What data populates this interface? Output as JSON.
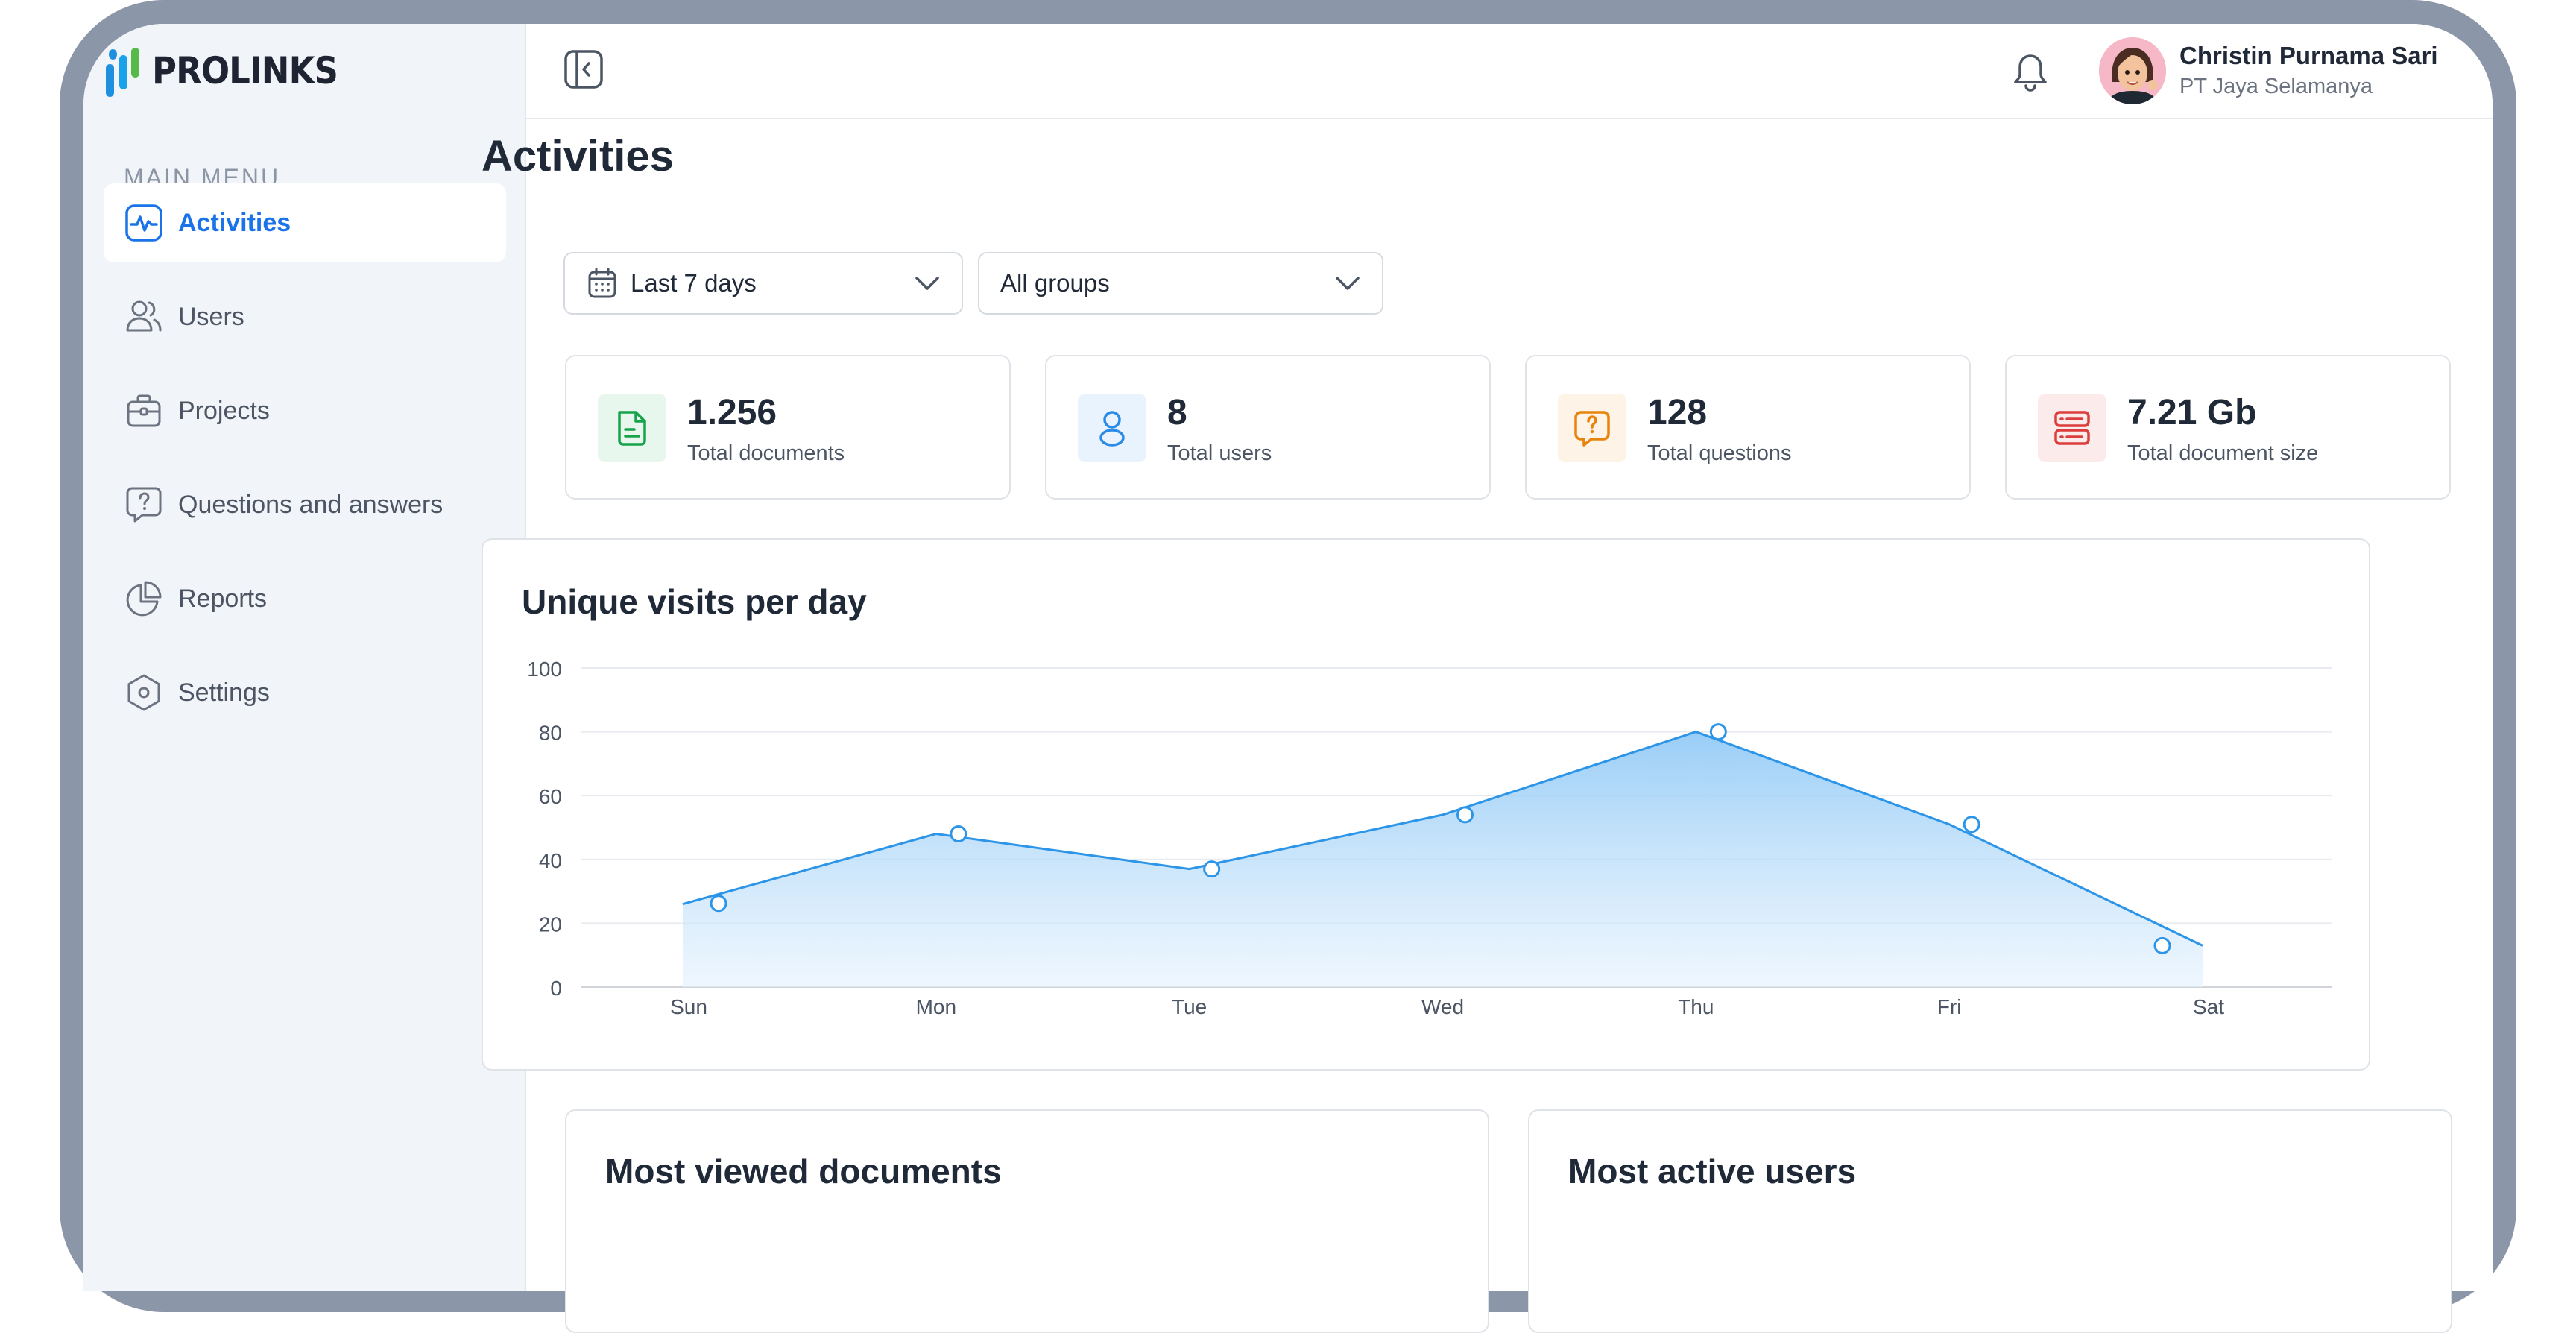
{
  "brand": {
    "name": "PROLINKS"
  },
  "sidebar": {
    "heading": "MAIN MENU",
    "items": [
      {
        "label": "Activities",
        "icon": "activity-icon",
        "active": true
      },
      {
        "label": "Users",
        "icon": "users-icon",
        "active": false
      },
      {
        "label": "Projects",
        "icon": "briefcase-icon",
        "active": false
      },
      {
        "label": "Questions and answers",
        "icon": "question-bubble-icon",
        "active": false
      },
      {
        "label": "Reports",
        "icon": "pie-chart-icon",
        "active": false
      },
      {
        "label": "Settings",
        "icon": "settings-icon",
        "active": false
      }
    ]
  },
  "header": {
    "user": {
      "name": "Christin Purnama Sari",
      "company": "PT Jaya Selamanya"
    }
  },
  "page": {
    "title": "Activities",
    "filters": {
      "period": "Last 7 days",
      "group": "All groups"
    }
  },
  "stats": [
    {
      "value": "1.256",
      "label": "Total documents",
      "icon": "document-icon",
      "color": "#16a34a",
      "bg": "#e8f7ee"
    },
    {
      "value": "8",
      "label": "Total users",
      "icon": "user-icon",
      "color": "#2b8be6",
      "bg": "#e9f3fd"
    },
    {
      "value": "128",
      "label": "Total questions",
      "icon": "question-icon",
      "color": "#e8830c",
      "bg": "#fdf3e6"
    },
    {
      "value": "7.21 Gb",
      "label": "Total document size",
      "icon": "storage-icon",
      "color": "#dc3d3d",
      "bg": "#fcebeb"
    }
  ],
  "chart_data": {
    "type": "area",
    "title": "Unique visits per day",
    "categories": [
      "Sun",
      "Mon",
      "Tue",
      "Wed",
      "Thu",
      "Fri",
      "Sat"
    ],
    "series": [
      {
        "values": [
          26,
          48,
          37,
          54,
          80,
          51,
          13
        ]
      }
    ],
    "ylim": [
      0,
      100
    ],
    "yticks": [
      0,
      20,
      40,
      60,
      80,
      100
    ],
    "grid": true,
    "color": "#2d95e8"
  },
  "panels": {
    "left_title": "Most viewed documents",
    "right_title": "Most active users"
  },
  "colors": {
    "accent": "#1a73e8",
    "frame": "#8b96a8",
    "sidebar_bg": "#f1f4f8"
  }
}
